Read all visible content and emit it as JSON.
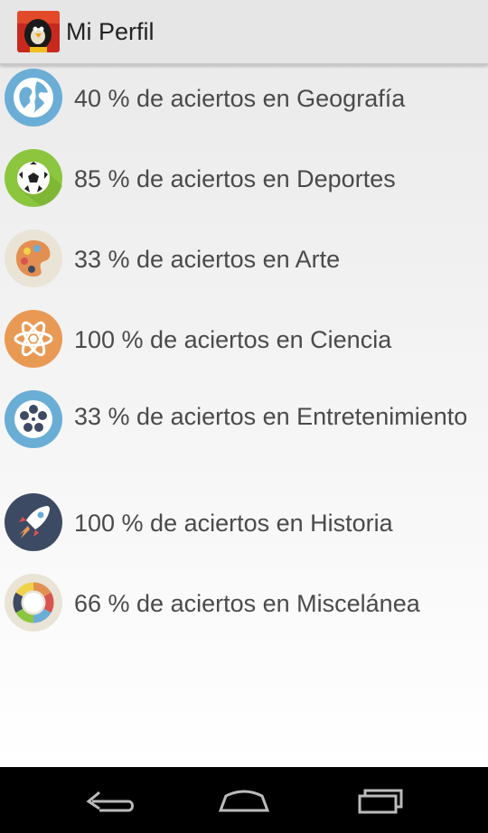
{
  "app": {
    "title": "Mi Perfil"
  },
  "rows": [
    {
      "label": "40 % de aciertos en Geografía",
      "icon": "globe-icon",
      "color": "#6aaed6"
    },
    {
      "label": "85 % de aciertos en Deportes",
      "icon": "soccer-ball-icon",
      "color": "#8cc63f"
    },
    {
      "label": "33 % de aciertos en Arte",
      "icon": "palette-icon",
      "color": "#e9e4d6"
    },
    {
      "label": "100 % de aciertos en Ciencia",
      "icon": "atom-icon",
      "color": "#e89a55"
    },
    {
      "label": "33 % de aciertos en Entretenimiento",
      "icon": "film-reel-icon",
      "color": "#6aaed6"
    },
    {
      "label": "100 % de aciertos en Historia",
      "icon": "rocket-icon",
      "color": "#3d4a63"
    },
    {
      "label": "66 % de aciertos en Miscelánea",
      "icon": "color-wheel-icon",
      "color": "#e9e4d6"
    }
  ],
  "navigation": {
    "back": "back-icon",
    "home": "home-icon",
    "recents": "recent-apps-icon"
  }
}
